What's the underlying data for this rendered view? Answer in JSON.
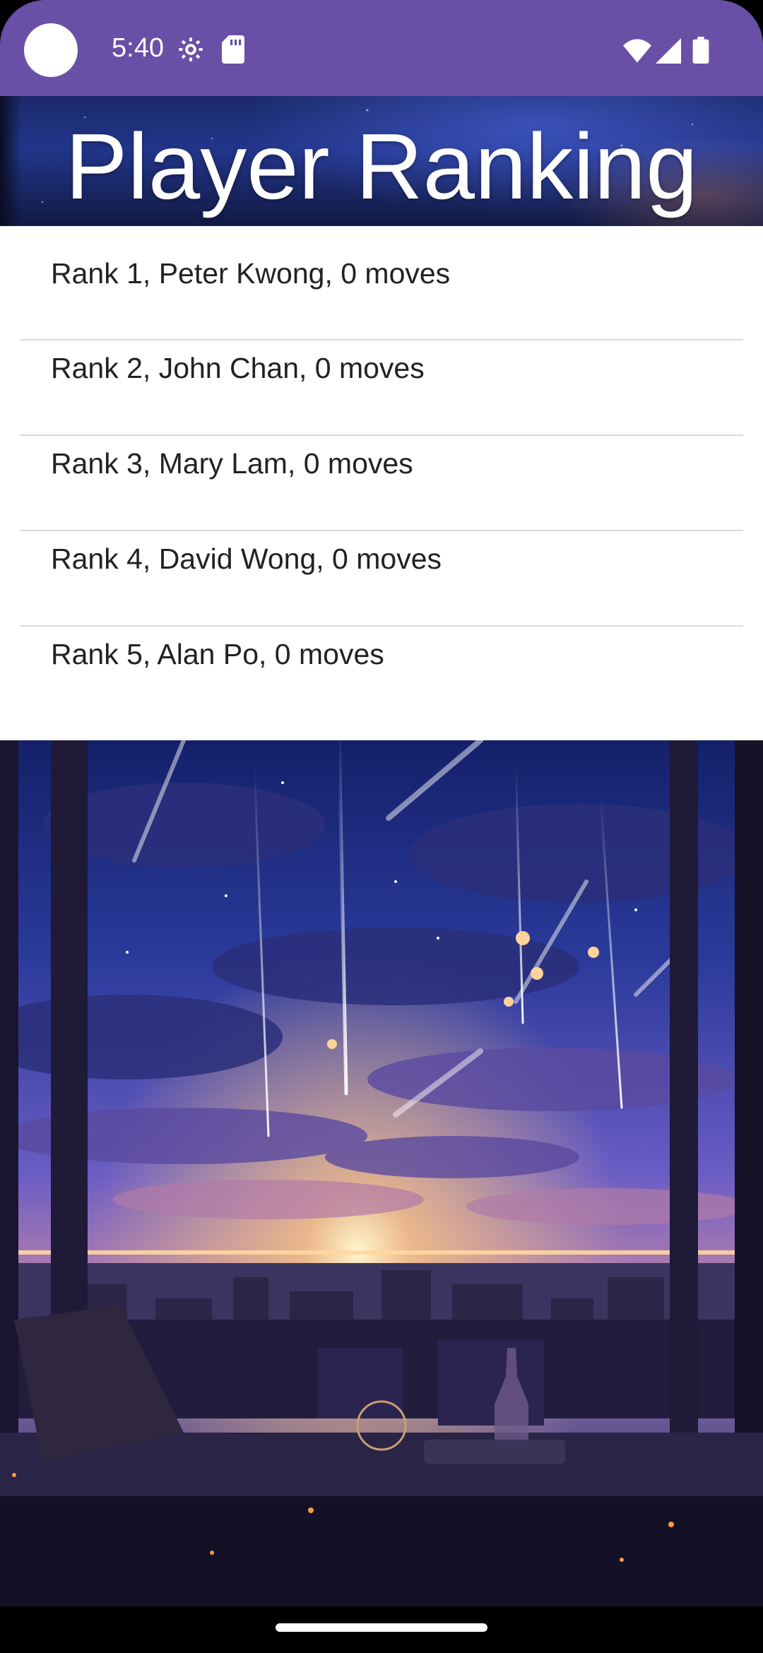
{
  "status_bar": {
    "time": "5:40",
    "icons": [
      "camera-dot",
      "settings-gear-icon",
      "sd-card-icon",
      "wifi-icon",
      "cell-signal-icon",
      "battery-icon"
    ],
    "color": "#6a4fa6"
  },
  "header": {
    "title": "Player Ranking"
  },
  "ranking": {
    "items": [
      {
        "label": "Rank 1, Peter Kwong, 0 moves"
      },
      {
        "label": "Rank 2, John Chan, 0 moves"
      },
      {
        "label": "Rank 3, Mary Lam, 0 moves"
      },
      {
        "label": "Rank 4, David Wong, 0 moves"
      },
      {
        "label": "Rank 5, Alan Po, 0 moves"
      }
    ]
  },
  "background": {
    "image": "night-sky-window-illustration"
  },
  "navigation": {
    "handle": "home-gesture-handle"
  }
}
